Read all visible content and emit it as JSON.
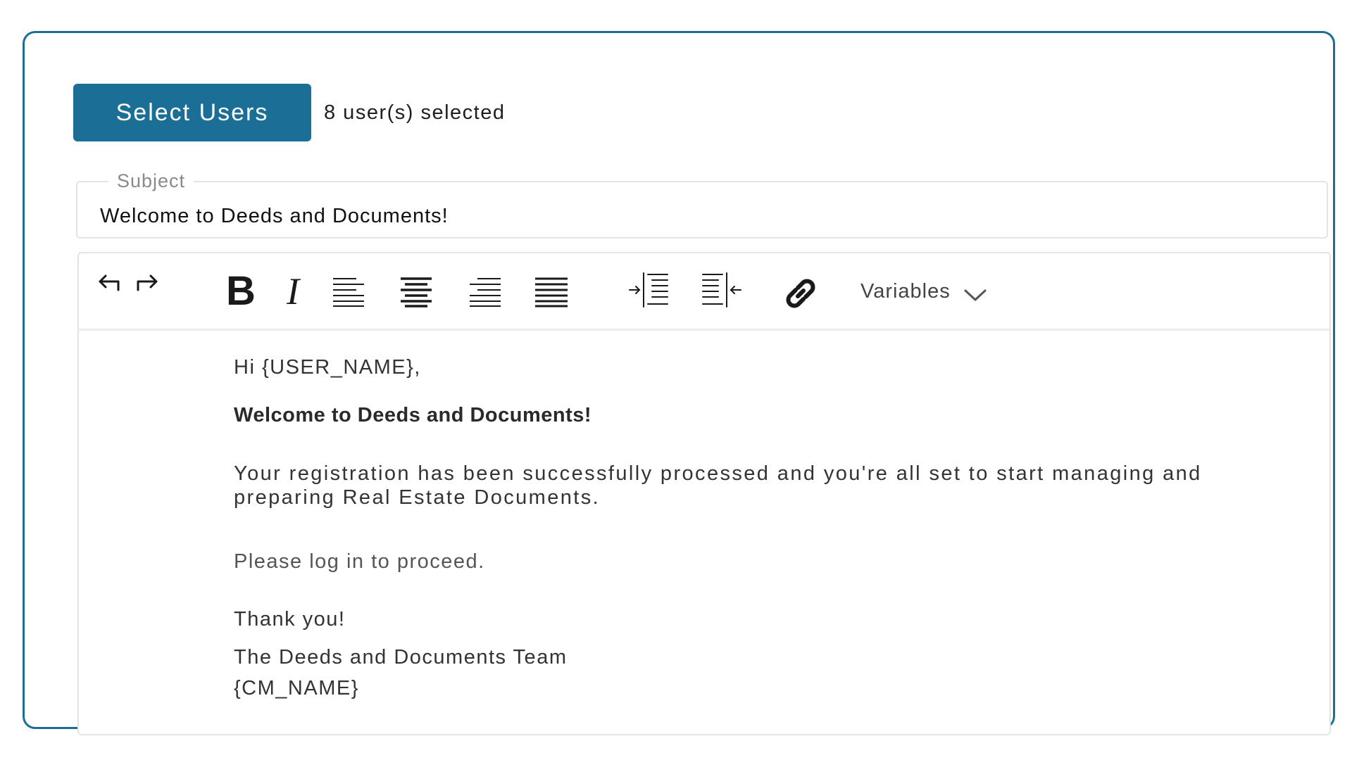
{
  "header": {
    "select_users_label": "Select Users",
    "selected_count_text": "8 user(s) selected"
  },
  "subject": {
    "label": "Subject",
    "value": "Welcome to Deeds and Documents!"
  },
  "toolbar": {
    "undo_icon": "undo-icon",
    "redo_icon": "redo-icon",
    "bold_glyph": "B",
    "italic_glyph": "I",
    "align_left_icon": "align-left-icon",
    "align_center_icon": "align-center-icon",
    "align_right_icon": "align-right-icon",
    "align_justify_icon": "align-justify-icon",
    "indent_icon": "indent-icon",
    "outdent_icon": "outdent-icon",
    "link_icon": "link-icon",
    "variables_label": "Variables",
    "variables_chevron_icon": "chevron-down-icon"
  },
  "body": {
    "greeting": "Hi {USER_NAME},",
    "heading": "Welcome to Deeds and Documents!",
    "paragraph": "Your registration has been successfully processed and you're all set to start managing and preparing Real Estate Documents.",
    "proceed": "Please log in to proceed.",
    "thanks": "Thank you!",
    "team": "The Deeds and Documents Team",
    "cm_name": "{CM_NAME}"
  },
  "colors": {
    "accent": "#1b6f96",
    "border": "#e4e4e4",
    "text": "#333333"
  }
}
